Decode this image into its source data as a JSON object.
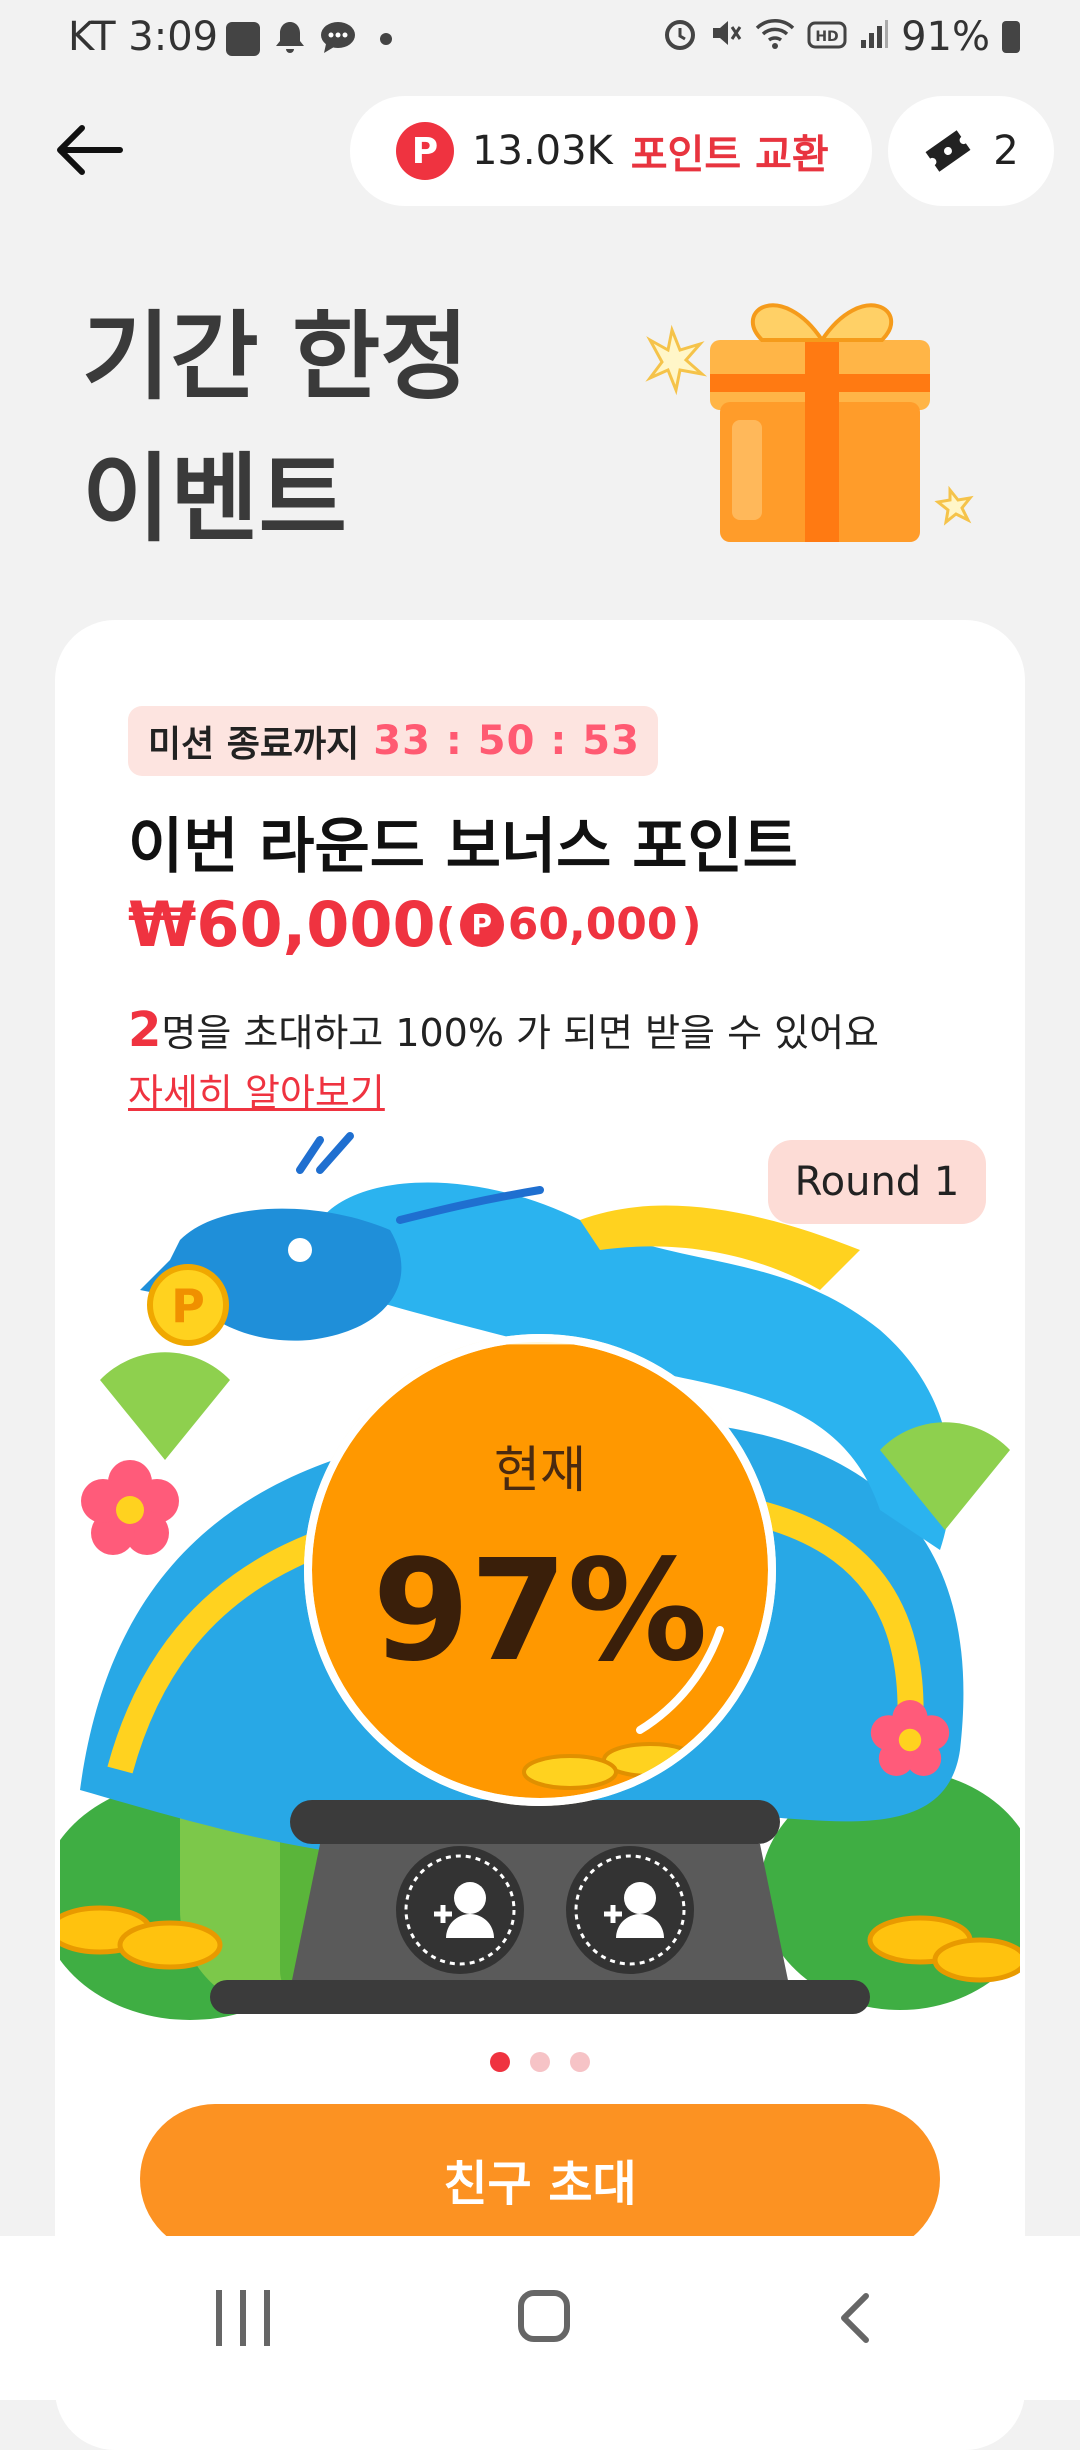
{
  "status_bar": {
    "time": "KT 3:09",
    "battery": "91%",
    "left_icons": [
      "image-icon",
      "bell-icon",
      "chat-icon",
      "dot-icon"
    ],
    "right_icons": [
      "alarm-icon",
      "mute-icon",
      "wifi-icon",
      "hd-icon",
      "signal-icon",
      "battery-icon"
    ]
  },
  "header": {
    "points_amount": "13.03K",
    "points_exchange_label": "포인트 교환",
    "point_badge": "P",
    "ticket_count": "2"
  },
  "hero": {
    "title_line1": "기간 한정",
    "title_line2": "이벤트"
  },
  "mission": {
    "timer_label": "미션 종료까지",
    "timer_value": "33 : 50 : 53",
    "bonus_title": "이번 라운드 보너스 포인트",
    "bonus_krw": "₩60,000",
    "bonus_paren_open": "(",
    "bonus_points": "60,000",
    "bonus_paren_close": ")",
    "invite_count": "2",
    "invite_desc": "명을 초대하고 100% 가 되면 받을 수 있어요",
    "learn_more": "자세히 알아보기",
    "round_label": "Round 1",
    "progress_label": "현재",
    "progress_percent": "97%",
    "progress_value": 0.97
  },
  "pager": {
    "count": 3,
    "active_index": 0
  },
  "cta": {
    "invite_button": "친구 초대"
  },
  "colors": {
    "accent_red": "#ef3340",
    "orange": "#fc9222",
    "timer_pink": "#ff5a72",
    "chip_bg": "#fde4e0"
  }
}
